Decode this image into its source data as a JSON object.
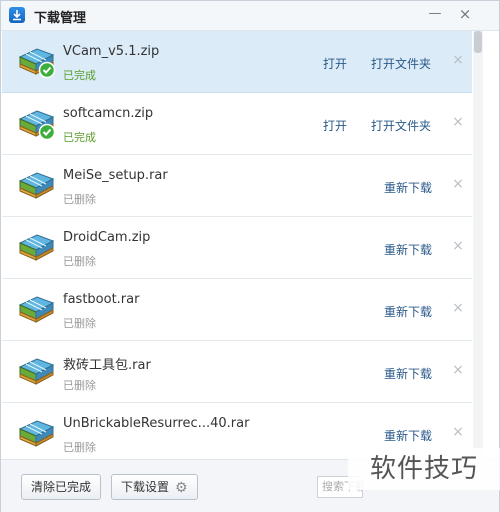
{
  "window": {
    "title": "下载管理",
    "minimize_glyph": "—",
    "close_glyph": "×"
  },
  "downloads": [
    {
      "name": "VCam_v5.1.zip",
      "status": "已完成",
      "state": "done",
      "selected": true,
      "actions": {
        "open": "打开",
        "folder": "打开文件夹"
      }
    },
    {
      "name": "softcamcn.zip",
      "status": "已完成",
      "state": "done",
      "selected": false,
      "actions": {
        "open": "打开",
        "folder": "打开文件夹"
      }
    },
    {
      "name": "MeiSe_setup.rar",
      "status": "已删除",
      "state": "deleted",
      "selected": false,
      "actions": {
        "redownload": "重新下载"
      }
    },
    {
      "name": "DroidCam.zip",
      "status": "已删除",
      "state": "deleted",
      "selected": false,
      "actions": {
        "redownload": "重新下载"
      }
    },
    {
      "name": "fastboot.rar",
      "status": "已删除",
      "state": "deleted",
      "selected": false,
      "actions": {
        "redownload": "重新下载"
      }
    },
    {
      "name": "救砖工具包.rar",
      "status": "已删除",
      "state": "deleted",
      "selected": false,
      "actions": {
        "redownload": "重新下载"
      }
    },
    {
      "name": "UnBrickableResurrec...40.rar",
      "status": "已删除",
      "state": "deleted",
      "selected": false,
      "actions": {
        "redownload": "重新下载"
      }
    }
  ],
  "row_close_glyph": "×",
  "footer": {
    "clear_label": "清除已完成",
    "settings_label": "下载设置",
    "search_placeholder": "搜索下载"
  },
  "watermark": "软件技巧",
  "colors": {
    "selected_row": "#dcebf8",
    "done_status": "#5a9d2a",
    "deleted_status": "#999999",
    "action_link": "#2a5a8a"
  }
}
